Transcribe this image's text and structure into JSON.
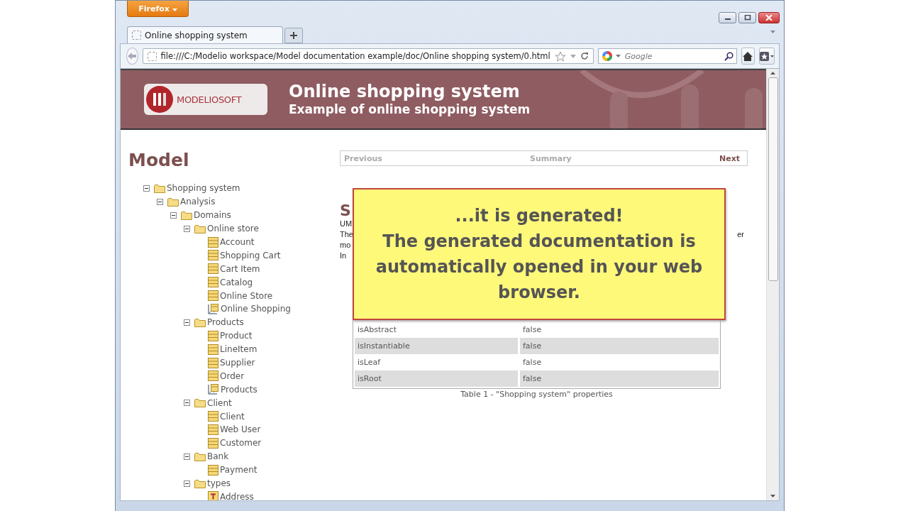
{
  "browser": {
    "menu_button": "Firefox",
    "tabs": [
      {
        "label": "Online shopping system",
        "selected": true
      }
    ],
    "address": "file:///C:/Modelio workspace/Model documentation example/doc/Online shopping system/0.html",
    "search": {
      "placeholder": "Google"
    }
  },
  "banner": {
    "title": "Online shopping system",
    "subtitle": "Example of online shopping system",
    "logo": "MODELIOSOFT"
  },
  "sidebar": {
    "heading": "Model",
    "tree": [
      {
        "label": "Shopping system",
        "kind": "folder",
        "expanded": true,
        "children": [
          {
            "label": "Analysis",
            "kind": "folder",
            "expanded": true,
            "children": [
              {
                "label": "Domains",
                "kind": "folder",
                "expanded": true,
                "children": [
                  {
                    "label": "Online store",
                    "kind": "folder",
                    "expanded": true,
                    "children": [
                      {
                        "label": "Account",
                        "kind": "class"
                      },
                      {
                        "label": "Shopping Cart",
                        "kind": "class"
                      },
                      {
                        "label": "Cart Item",
                        "kind": "class"
                      },
                      {
                        "label": "Catalog",
                        "kind": "class"
                      },
                      {
                        "label": "Online Store",
                        "kind": "class"
                      },
                      {
                        "label": "Online Shopping",
                        "kind": "diagram"
                      }
                    ]
                  },
                  {
                    "label": "Products",
                    "kind": "folder",
                    "expanded": true,
                    "children": [
                      {
                        "label": "Product",
                        "kind": "class"
                      },
                      {
                        "label": "LineItem",
                        "kind": "class"
                      },
                      {
                        "label": "Supplier",
                        "kind": "class"
                      },
                      {
                        "label": "Order",
                        "kind": "class"
                      },
                      {
                        "label": "Products",
                        "kind": "diagram"
                      }
                    ]
                  },
                  {
                    "label": "Client",
                    "kind": "folder",
                    "expanded": true,
                    "children": [
                      {
                        "label": "Client",
                        "kind": "class"
                      },
                      {
                        "label": "Web User",
                        "kind": "class"
                      },
                      {
                        "label": "Customer",
                        "kind": "class"
                      }
                    ]
                  },
                  {
                    "label": "Bank",
                    "kind": "folder",
                    "expanded": true,
                    "children": [
                      {
                        "label": "Payment",
                        "kind": "class"
                      }
                    ]
                  },
                  {
                    "label": "types",
                    "kind": "folder",
                    "expanded": true,
                    "children": [
                      {
                        "label": "Address",
                        "kind": "datatype"
                      }
                    ]
                  }
                ]
              }
            ]
          }
        ]
      }
    ]
  },
  "nav": {
    "previous": "Previous",
    "summary": "Summary",
    "next": "Next"
  },
  "content": {
    "heading_fragment": "S",
    "text_fragments": [
      "UM",
      "The",
      "mo",
      "In"
    ],
    "right_fragment": "er"
  },
  "properties_table": {
    "rows": [
      {
        "name": "isAbstract",
        "value": "false"
      },
      {
        "name": "isInstantiable",
        "value": "false"
      },
      {
        "name": "isLeaf",
        "value": "false"
      },
      {
        "name": "isRoot",
        "value": "false"
      }
    ],
    "caption": "Table 1 - \"Shopping system\" properties"
  },
  "callout": {
    "lines": [
      "...it is generated!",
      "The generated documentation is automatically opened in your web browser."
    ]
  }
}
